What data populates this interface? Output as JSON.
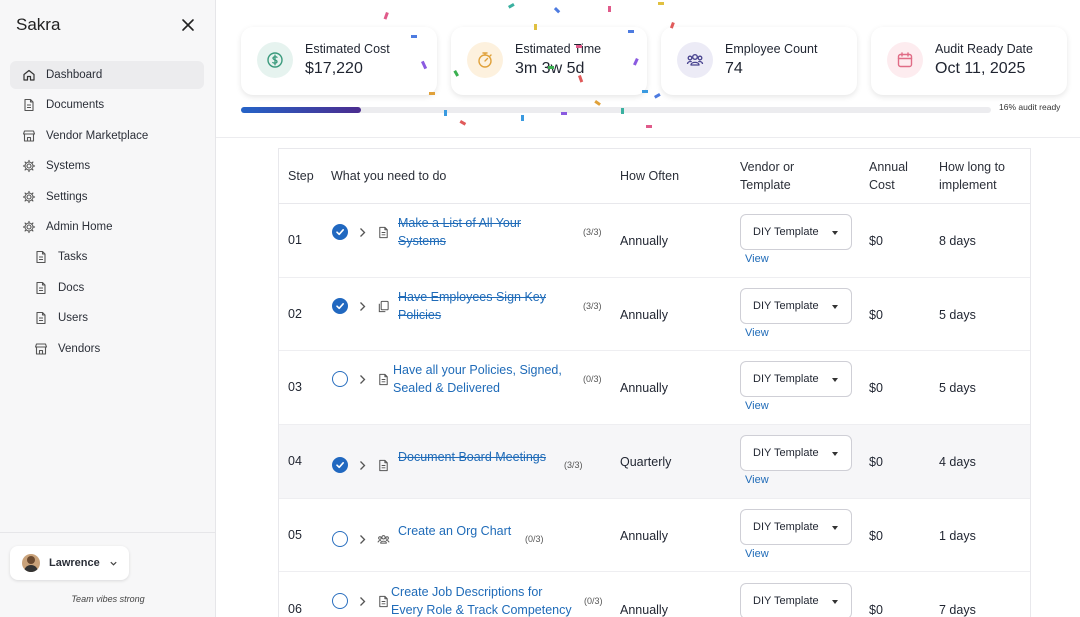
{
  "sidebar": {
    "brand": "Sakra",
    "items": [
      {
        "label": "Dashboard",
        "icon": "home-icon",
        "active": true
      },
      {
        "label": "Documents",
        "icon": "document-icon"
      },
      {
        "label": "Vendor Marketplace",
        "icon": "storefront-icon"
      },
      {
        "label": "Systems",
        "icon": "gear-icon"
      },
      {
        "label": "Settings",
        "icon": "gear-icon"
      },
      {
        "label": "Admin Home",
        "icon": "gear-icon"
      },
      {
        "label": "Tasks",
        "icon": "document-icon",
        "sub": true
      },
      {
        "label": "Docs",
        "icon": "document-icon",
        "sub": true
      },
      {
        "label": "Users",
        "icon": "document-icon",
        "sub": true
      },
      {
        "label": "Vendors",
        "icon": "storefront-icon",
        "sub": true
      }
    ],
    "user": {
      "name": "Lawrence"
    },
    "tagline": "Team vibes strong"
  },
  "stats": [
    {
      "label": "Estimated Cost",
      "value": "$17,220",
      "icon": "dollar-icon",
      "bg": "#e6f3ef",
      "color": "#3a9a7c"
    },
    {
      "label": "Estimated Time",
      "value": "3m 3w 5d",
      "icon": "stopwatch-icon",
      "bg": "#fdf1de",
      "color": "#e0a13a"
    },
    {
      "label": "Employee Count",
      "value": "74",
      "icon": "people-icon",
      "bg": "#ecebf6",
      "color": "#4a4590"
    },
    {
      "label": "Audit Ready Date",
      "value": "Oct 11, 2025",
      "icon": "calendar-icon",
      "bg": "#fdecef",
      "color": "#e06c86"
    }
  ],
  "progress": {
    "fraction": 0.16,
    "label": "16% audit ready"
  },
  "table": {
    "headers": {
      "step": "Step",
      "task": "What you need to do",
      "often": "How Often",
      "vendor_line1": "Vendor or",
      "vendor_line2": "Template",
      "cost_line1": "Annual",
      "cost_line2": "Cost",
      "impl_line1": "How long to",
      "impl_line2": "implement"
    },
    "rows": [
      {
        "step": "01",
        "checked": true,
        "icon": "document-icon",
        "line1": "Make a List of All Your",
        "line2": "Systems",
        "count": "(3/3)",
        "often": "Annually",
        "template": "DIY Template",
        "view": "View",
        "cost": "$0",
        "impl": "8 days"
      },
      {
        "step": "02",
        "checked": true,
        "icon": "copy-icon",
        "line1": "Have Employees Sign Key",
        "line2": "Policies",
        "count": "(3/3)",
        "often": "Annually",
        "template": "DIY Template",
        "view": "View",
        "cost": "$0",
        "impl": "5 days"
      },
      {
        "step": "03",
        "checked": false,
        "icon": "document-icon",
        "line1": "Have all your Policies, Signed,",
        "line2": "Sealed & Delivered",
        "count": "(0/3)",
        "often": "Annually",
        "template": "DIY Template",
        "view": "View",
        "cost": "$0",
        "impl": "5 days"
      },
      {
        "step": "04",
        "checked": true,
        "icon": "document-icon",
        "line1": "Document Board Meetings",
        "line2": "",
        "count": "(3/3)",
        "often": "Quarterly",
        "template": "DIY Template",
        "view": "View",
        "cost": "$0",
        "impl": "4 days",
        "highlight": true
      },
      {
        "step": "05",
        "checked": false,
        "icon": "people-icon",
        "line1": "Create an Org Chart",
        "line2": "",
        "count": "(0/3)",
        "often": "Annually",
        "template": "DIY Template",
        "view": "View",
        "cost": "$0",
        "impl": "1 days"
      },
      {
        "step": "06",
        "checked": false,
        "icon": "document-icon",
        "line1": "Create Job Descriptions for",
        "line2": "Every Role & Track Competency",
        "count": "(0/3)",
        "often": "Annually",
        "template": "DIY Template",
        "view": "View",
        "cost": "$0",
        "impl": "7 days"
      }
    ]
  }
}
